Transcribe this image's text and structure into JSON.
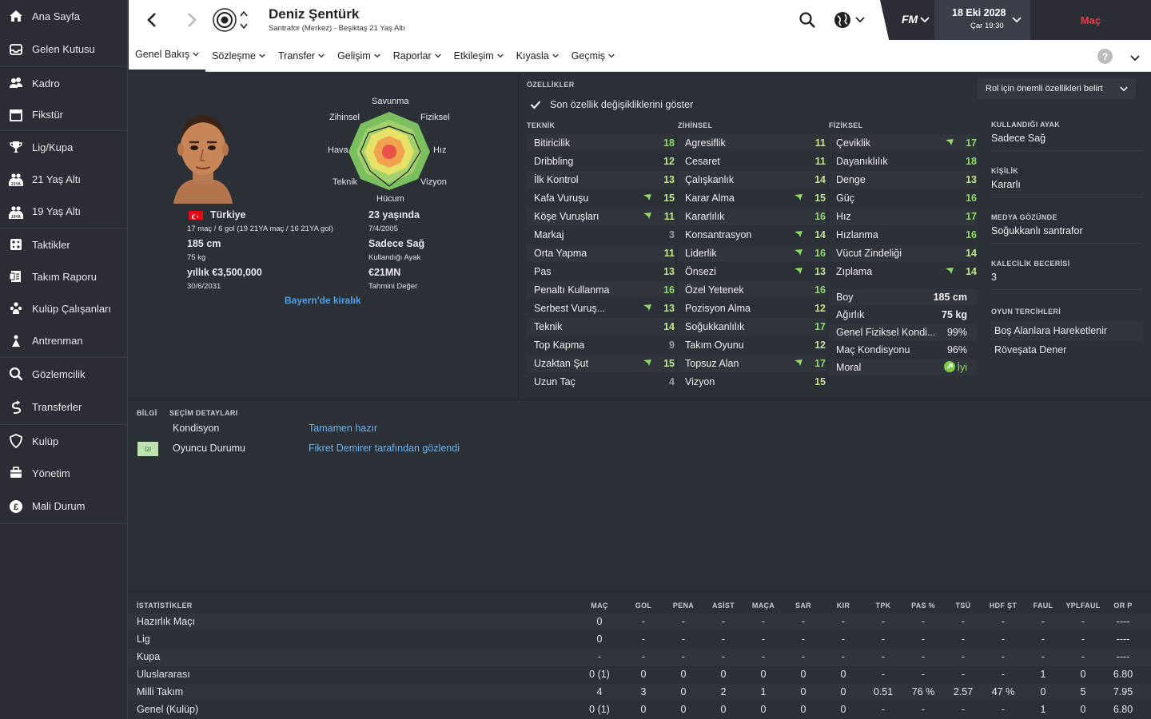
{
  "sidebar": {
    "items": [
      {
        "label": "Ana Sayfa",
        "icon": "home-icon"
      },
      {
        "label": "Gelen Kutusu",
        "icon": "inbox-icon"
      },
      {
        "label": "Kadro",
        "icon": "squad-icon"
      },
      {
        "label": "Fikstür",
        "icon": "calendar-icon"
      },
      {
        "label": "Lig/Kupa",
        "icon": "trophy-icon"
      },
      {
        "label": "21 Yaş Altı",
        "icon": "u21-icon",
        "badge": "21YA"
      },
      {
        "label": "19 Yaş Altı",
        "icon": "u19-icon",
        "badge": "19YA"
      },
      {
        "label": "Taktikler",
        "icon": "tactics-icon"
      },
      {
        "label": "Takım Raporu",
        "icon": "report-icon"
      },
      {
        "label": "Kulüp Çalışanları",
        "icon": "staff-icon"
      },
      {
        "label": "Antrenman",
        "icon": "training-icon"
      },
      {
        "label": "Gözlemcilik",
        "icon": "scouting-icon"
      },
      {
        "label": "Transferler",
        "icon": "transfers-icon"
      },
      {
        "label": "Kulüp",
        "icon": "club-icon"
      },
      {
        "label": "Yönetim",
        "icon": "board-icon"
      },
      {
        "label": "Mali Durum",
        "icon": "finance-icon"
      }
    ]
  },
  "header": {
    "player_name": "Deniz Şentürk",
    "player_subtitle": "Santrafor (Merkez) - Beşiktaş 21 Yaş Altı",
    "fm_label": "FM",
    "date": "18 Eki 2028",
    "day_time": "Çar 19:30",
    "match_button": "Maç",
    "accent": "#e8404b"
  },
  "tabs": [
    {
      "label": "Genel Bakış",
      "active": true
    },
    {
      "label": "Sözleşme"
    },
    {
      "label": "Transfer"
    },
    {
      "label": "Gelişim"
    },
    {
      "label": "Raporlar"
    },
    {
      "label": "Etkileşim"
    },
    {
      "label": "Kıyasla"
    },
    {
      "label": "Geçmiş"
    }
  ],
  "help_label": "?",
  "profile": {
    "radar_labels": {
      "top": "Savunma",
      "top_left": "Zihinsel",
      "top_right": "Fiziksel",
      "left": "Hava",
      "right": "Hız",
      "bottom_left": "Teknik",
      "bottom_right": "Vizyon",
      "bottom": "Hücum"
    },
    "nationality": "Türkiye",
    "caps": "17 maç / 6 gol (19 21YA maç / 16 21YA gol)",
    "height": "185 cm",
    "weight": "75 kg",
    "wage": "yıllık €3,500,000",
    "contract_end": "30/6/2031",
    "age": "23 yaşında",
    "dob": "7/4/2005",
    "foot": "Sadece Sağ",
    "foot_label": "Kullandığı Ayak",
    "value": "€21MN",
    "value_label": "Tahmini Değer",
    "loan_status": "Bayern'de kiralık"
  },
  "attributes": {
    "section_title": "ÖZELLİKLER",
    "show_changes_label": "Son özellik değişikliklerini göster",
    "role_button": "Rol için önemli özellikleri belirt",
    "technical_title": "TEKNİK",
    "mental_title": "ZİHİNSEL",
    "physical_title": "FİZİKSEL",
    "technical": [
      {
        "name": "Bitiricilik",
        "value": "18",
        "up": false
      },
      {
        "name": "Dribbling",
        "value": "12",
        "up": false
      },
      {
        "name": "İlk Kontrol",
        "value": "13",
        "up": false
      },
      {
        "name": "Kafa Vuruşu",
        "value": "15",
        "up": true
      },
      {
        "name": "Köşe Vuruşları",
        "value": "11",
        "up": true
      },
      {
        "name": "Markaj",
        "value": "3",
        "up": false
      },
      {
        "name": "Orta Yapma",
        "value": "11",
        "up": false
      },
      {
        "name": "Pas",
        "value": "13",
        "up": false
      },
      {
        "name": "Penaltı Kullanma",
        "value": "16",
        "up": false
      },
      {
        "name": "Serbest Vuruş...",
        "value": "13",
        "up": true
      },
      {
        "name": "Teknik",
        "value": "14",
        "up": false
      },
      {
        "name": "Top Kapma",
        "value": "9",
        "up": false
      },
      {
        "name": "Uzaktan Şut",
        "value": "15",
        "up": true
      },
      {
        "name": "Uzun Taç",
        "value": "4",
        "up": false
      }
    ],
    "mental": [
      {
        "name": "Agresiflik",
        "value": "11",
        "up": false
      },
      {
        "name": "Cesaret",
        "value": "11",
        "up": false
      },
      {
        "name": "Çalışkanlık",
        "value": "14",
        "up": false
      },
      {
        "name": "Karar Alma",
        "value": "15",
        "up": true
      },
      {
        "name": "Kararlılık",
        "value": "16",
        "up": false
      },
      {
        "name": "Konsantrasyon",
        "value": "14",
        "up": true
      },
      {
        "name": "Liderlik",
        "value": "16",
        "up": true
      },
      {
        "name": "Önsezi",
        "value": "13",
        "up": true
      },
      {
        "name": "Özel Yetenek",
        "value": "16",
        "up": false
      },
      {
        "name": "Pozisyon Alma",
        "value": "12",
        "up": false
      },
      {
        "name": "Soğukkanlılık",
        "value": "17",
        "up": false
      },
      {
        "name": "Takım Oyunu",
        "value": "12",
        "up": false
      },
      {
        "name": "Topsuz Alan",
        "value": "17",
        "up": true
      },
      {
        "name": "Vizyon",
        "value": "15",
        "up": false
      }
    ],
    "physical": [
      {
        "name": "Çeviklik",
        "value": "17",
        "up": true
      },
      {
        "name": "Dayanıklılık",
        "value": "18",
        "up": false
      },
      {
        "name": "Denge",
        "value": "13",
        "up": false
      },
      {
        "name": "Güç",
        "value": "16",
        "up": false
      },
      {
        "name": "Hız",
        "value": "17",
        "up": false
      },
      {
        "name": "Hızlanma",
        "value": "16",
        "up": false
      },
      {
        "name": "Vücut Zindeliği",
        "value": "14",
        "up": false
      },
      {
        "name": "Zıplama",
        "value": "14",
        "up": true
      }
    ],
    "physical_extra": [
      {
        "name": "Boy",
        "value": "185 cm"
      },
      {
        "name": "Ağırlık",
        "value": "75 kg"
      },
      {
        "name": "Genel Fiziksel Kondi...",
        "value": "99%"
      },
      {
        "name": "Maç Kondisyonu",
        "value": "96%"
      },
      {
        "name": "Moral",
        "value": "İyi"
      }
    ]
  },
  "right_panel": {
    "foot_title": "KULLANDIĞI AYAK",
    "foot_value": "Sadece Sağ",
    "personality_title": "KİŞİLİK",
    "personality_value": "Kararlı",
    "media_title": "MEDYA GÖZÜNDE",
    "media_value": "Soğukkanlı santrafor",
    "gk_title": "KALECİLİK BECERİSİ",
    "gk_value": "3",
    "prefs_title": "OYUN TERCİHLERİ",
    "prefs": [
      "Boş Alanlara Hareketlenir",
      "Röveşata Dener"
    ]
  },
  "info": {
    "tab_info": "BİLGİ",
    "tab_selection": "SEÇİM DETAYLARI",
    "rows": [
      {
        "label": "Kondisyon",
        "value": "Tamamen hazır",
        "badge": ""
      },
      {
        "label": "Oyuncu Durumu",
        "value": "Fikret Demirer tarafından gözlendi",
        "badge": "İzl"
      }
    ]
  },
  "stats": {
    "title": "İSTATİSTİKLER",
    "columns": [
      "MAÇ",
      "GOL",
      "PENA",
      "ASİST",
      "MAÇA",
      "SAR",
      "KIR",
      "TPK",
      "PAS %",
      "TSÜ",
      "HDF ŞT",
      "FAUL",
      "YPLFAUL",
      "OR P"
    ],
    "rows": [
      {
        "name": "Hazırlık Maçı",
        "cells": [
          "0",
          "-",
          "-",
          "-",
          "-",
          "-",
          "-",
          "-",
          "-",
          "-",
          "-",
          "-",
          "-",
          "----"
        ]
      },
      {
        "name": "Lig",
        "cells": [
          "0",
          "-",
          "-",
          "-",
          "-",
          "-",
          "-",
          "-",
          "-",
          "-",
          "-",
          "-",
          "-",
          "----"
        ]
      },
      {
        "name": "Kupa",
        "cells": [
          "-",
          "-",
          "-",
          "-",
          "-",
          "-",
          "-",
          "-",
          "-",
          "-",
          "-",
          "-",
          "-",
          "----"
        ]
      },
      {
        "name": "Uluslararası",
        "cells": [
          "0 (1)",
          "0",
          "0",
          "0",
          "0",
          "0",
          "0",
          "-",
          "-",
          "-",
          "-",
          "1",
          "0",
          "6.80"
        ]
      },
      {
        "name": "Milli Takım",
        "cells": [
          "4",
          "3",
          "0",
          "2",
          "1",
          "0",
          "0",
          "0.51",
          "76 %",
          "2.57",
          "47 %",
          "0",
          "5",
          "7.95"
        ]
      },
      {
        "name": "Genel (Kulüp)",
        "cells": [
          "0 (1)",
          "0",
          "0",
          "0",
          "0",
          "0",
          "0",
          "-",
          "-",
          "-",
          "-",
          "1",
          "0",
          "6.80"
        ]
      }
    ]
  }
}
